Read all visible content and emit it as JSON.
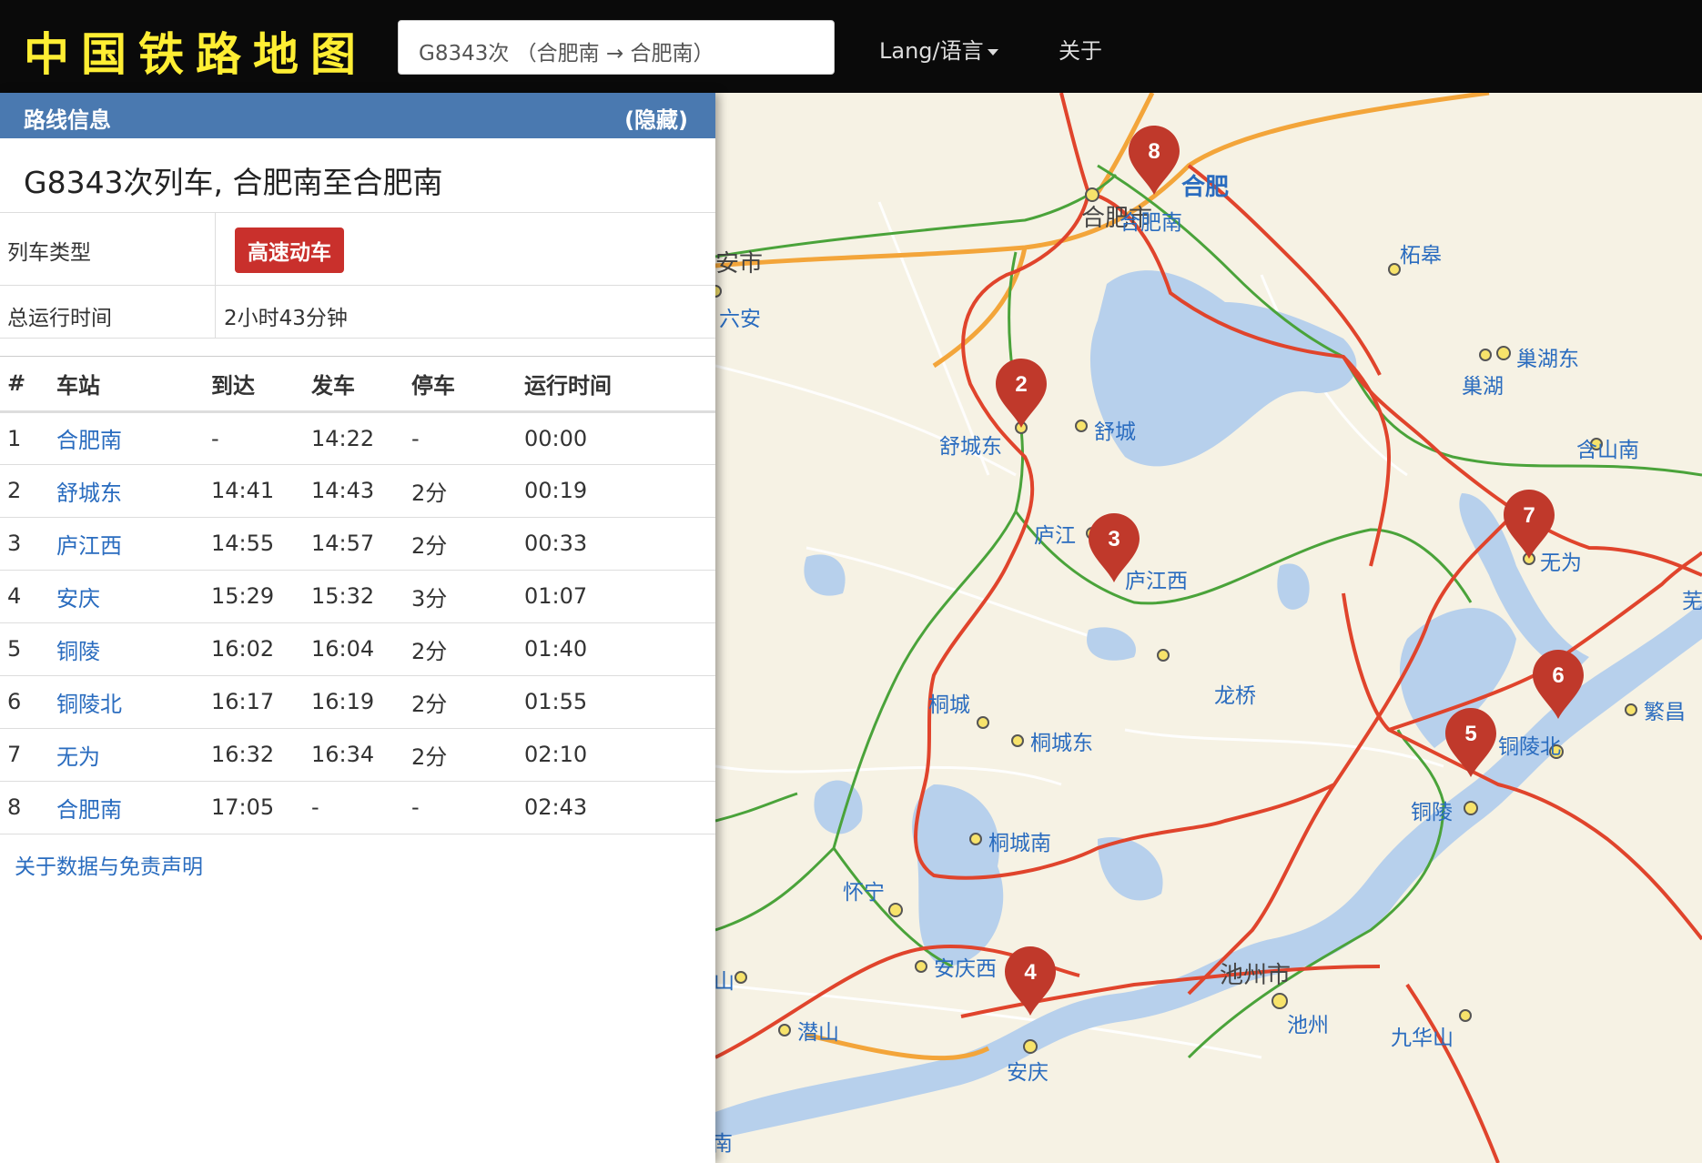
{
  "header": {
    "brand": "中国铁路地图",
    "search_value": "G8343次 （合肥南 → 合肥南）",
    "lang_label": "Lang/语言",
    "about_label": "关于"
  },
  "panel": {
    "title": "路线信息",
    "hide_label": "(隐藏)",
    "route_title": "G8343次列车, 合肥南至合肥南",
    "train_type_label": "列车类型",
    "train_type_value": "高速动车",
    "total_time_label": "总运行时间",
    "total_time_value": "2小时43分钟",
    "columns": [
      "#",
      "车站",
      "到达",
      "发车",
      "停车",
      "运行时间"
    ],
    "stops": [
      {
        "no": "1",
        "station": "合肥南",
        "arrive": "-",
        "depart": "14:22",
        "stop": "-",
        "elapsed": "00:00"
      },
      {
        "no": "2",
        "station": "舒城东",
        "arrive": "14:41",
        "depart": "14:43",
        "stop": "2分",
        "elapsed": "00:19"
      },
      {
        "no": "3",
        "station": "庐江西",
        "arrive": "14:55",
        "depart": "14:57",
        "stop": "2分",
        "elapsed": "00:33"
      },
      {
        "no": "4",
        "station": "安庆",
        "arrive": "15:29",
        "depart": "15:32",
        "stop": "3分",
        "elapsed": "01:07"
      },
      {
        "no": "5",
        "station": "铜陵",
        "arrive": "16:02",
        "depart": "16:04",
        "stop": "2分",
        "elapsed": "01:40"
      },
      {
        "no": "6",
        "station": "铜陵北",
        "arrive": "16:17",
        "depart": "16:19",
        "stop": "2分",
        "elapsed": "01:55"
      },
      {
        "no": "7",
        "station": "无为",
        "arrive": "16:32",
        "depart": "16:34",
        "stop": "2分",
        "elapsed": "02:10"
      },
      {
        "no": "8",
        "station": "合肥南",
        "arrive": "17:05",
        "depart": "-",
        "stop": "-",
        "elapsed": "02:43"
      }
    ],
    "disclaimer": "关于数据与免责声明"
  },
  "map": {
    "colors": {
      "land": "#f6f2e4",
      "water": "#b7d0ec",
      "hsr": "#e0442c",
      "conventional": "#4aa33a",
      "highway": "#f3a53a",
      "marker": "#c0392b",
      "label": "#2a6cbf"
    },
    "city_labels": [
      "合肥市",
      "合肥",
      "六安",
      "安市",
      "池州市",
      "芜",
      "山",
      "南"
    ],
    "station_labels": [
      "合肥南",
      "柘皋",
      "巢湖东",
      "巢湖",
      "含山南",
      "舒城东",
      "舒城",
      "庐江",
      "庐江西",
      "无为",
      "龙桥",
      "桐城",
      "桐城东",
      "桐城南",
      "怀宁",
      "安庆西",
      "安庆",
      "潜山",
      "池州",
      "九华山",
      "铜陵",
      "铜陵北",
      "繁昌"
    ],
    "marker_labels": [
      "8",
      "2",
      "3",
      "7",
      "6",
      "5",
      "4"
    ]
  }
}
